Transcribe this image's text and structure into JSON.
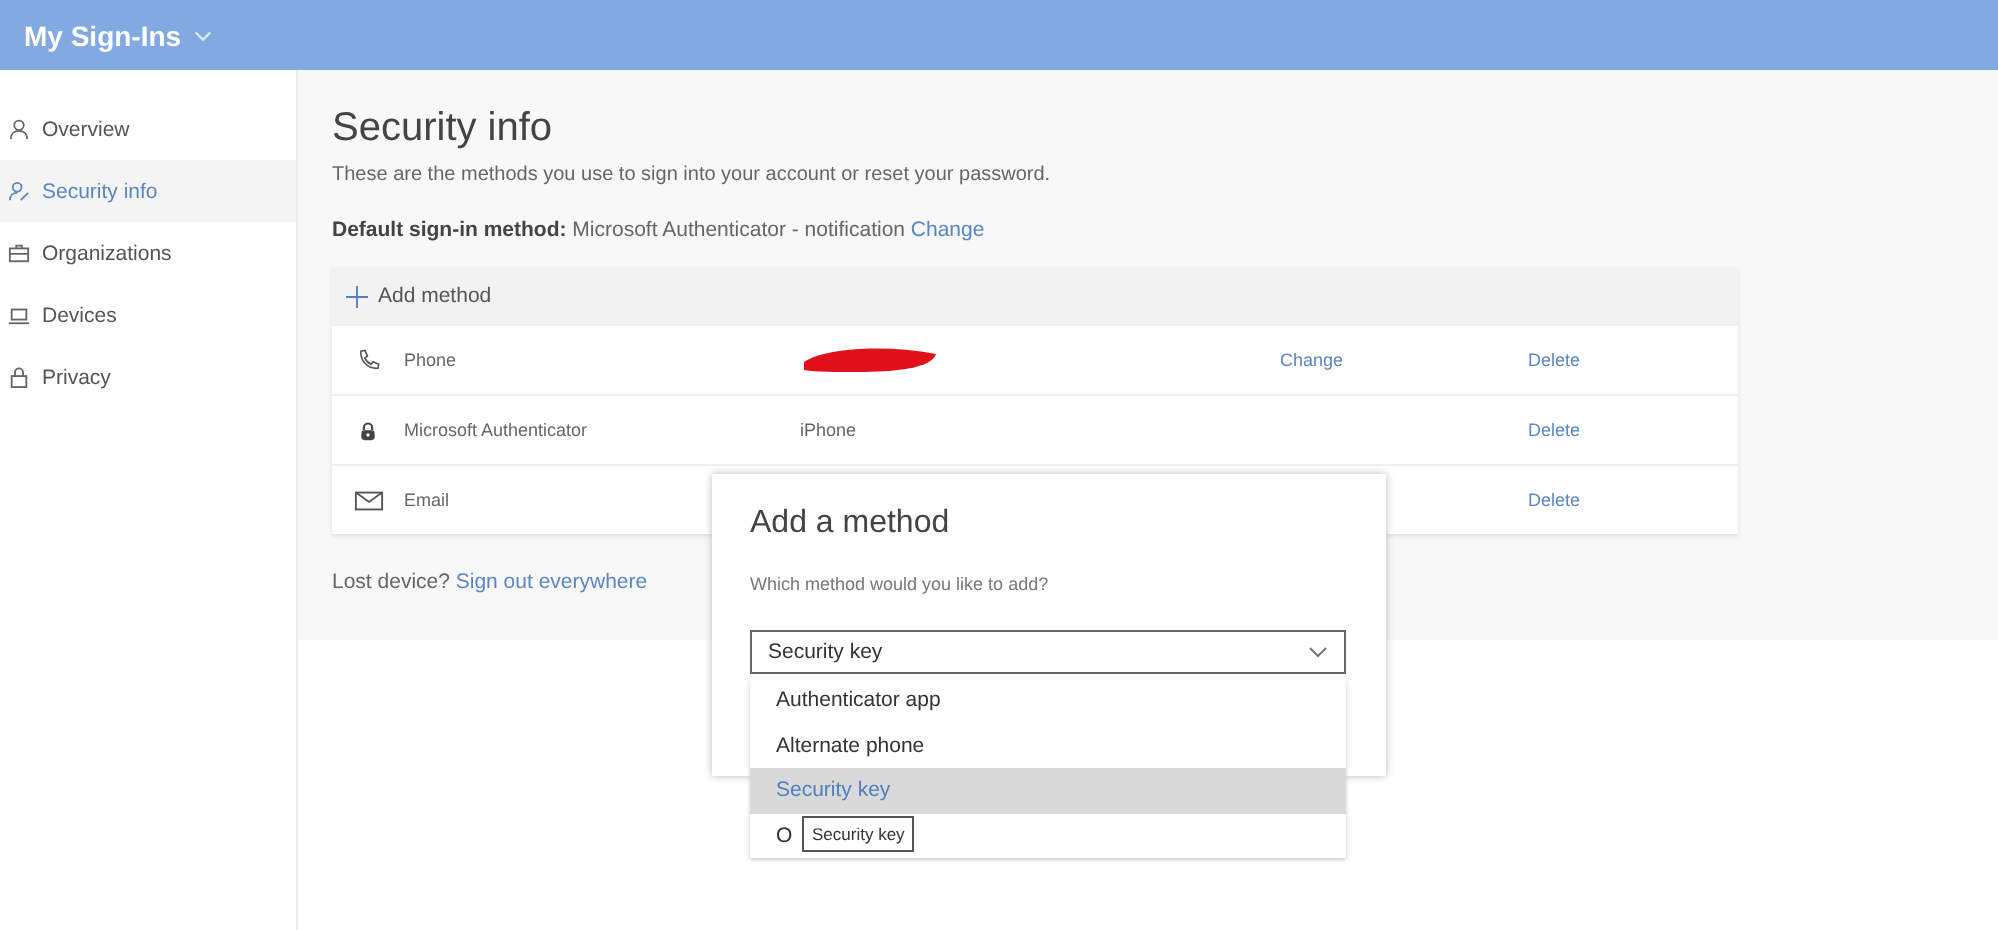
{
  "header": {
    "title": "My Sign-Ins"
  },
  "sidebar": {
    "items": [
      {
        "kind": "user",
        "label": "Overview",
        "selected": false
      },
      {
        "kind": "user-edit",
        "label": "Security info",
        "selected": true
      },
      {
        "kind": "briefcase",
        "label": "Organizations",
        "selected": false
      },
      {
        "kind": "laptop",
        "label": "Devices",
        "selected": false
      },
      {
        "kind": "lock",
        "label": "Privacy",
        "selected": false
      }
    ]
  },
  "page": {
    "title": "Security info",
    "description": "These are the methods you use to sign into your account or reset your password.",
    "default_method": {
      "label": "Default sign-in method:",
      "value": "Microsoft Authenticator - notification",
      "link": "Change"
    }
  },
  "methods": {
    "add_label": "Add method",
    "rows": [
      {
        "kind": "phone",
        "name": "Phone",
        "redacted": true,
        "change": "Change",
        "delete": "Delete"
      },
      {
        "kind": "authenticator",
        "name": "Microsoft Authenticator",
        "detail": "iPhone",
        "delete": "Delete"
      },
      {
        "kind": "email",
        "name": "Email",
        "delete": "Delete"
      }
    ]
  },
  "lost_device": {
    "text": "Lost device?",
    "link": "Sign out everywhere"
  },
  "dialog": {
    "title": "Add a method",
    "prompt": "Which method would you like to add?",
    "select": {
      "value": "Security key",
      "expanded": true,
      "options": [
        {
          "label": "Authenticator app",
          "selected": false
        },
        {
          "label": "Alternate phone",
          "selected": false
        },
        {
          "label": "Security key",
          "selected": true
        },
        {
          "label": "O",
          "selected": false
        }
      ]
    },
    "tooltip": "Security key"
  }
}
